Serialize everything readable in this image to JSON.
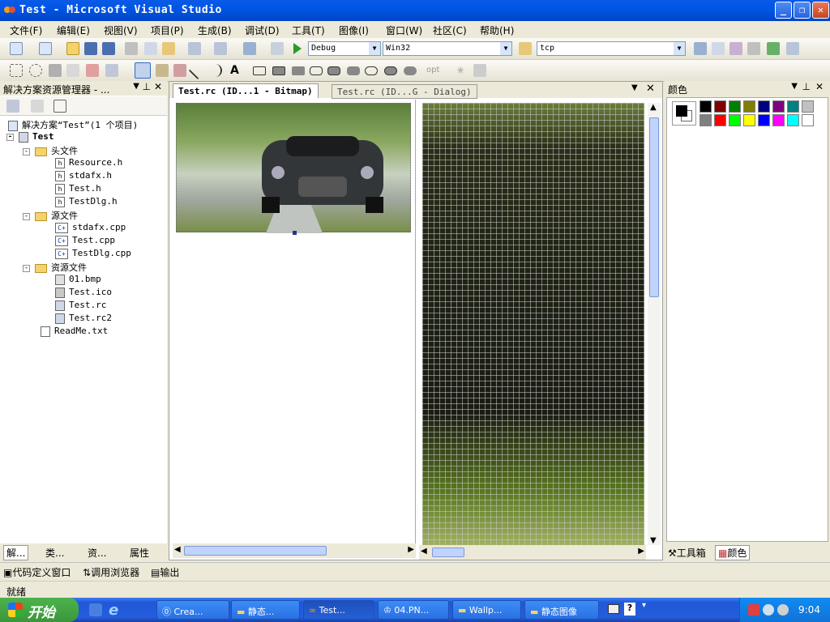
{
  "window": {
    "title": "Test - Microsoft Visual Studio"
  },
  "menu": [
    "文件(F)",
    "编辑(E)",
    "视图(V)",
    "项目(P)",
    "生成(B)",
    "调试(D)",
    "工具(T)",
    "图像(I)",
    "窗口(W)",
    "社区(C)",
    "帮助(H)"
  ],
  "toolbar": {
    "config": "Debug",
    "platform": "Win32",
    "find": "tcp",
    "opt_label": "opt"
  },
  "solution_explorer": {
    "title": "解决方案资源管理器 - ...",
    "solution_label": "解决方案“Test”(1 个项目)",
    "project": "Test",
    "folders": [
      {
        "name": "头文件",
        "files": [
          "Resource.h",
          "stdafx.h",
          "Test.h",
          "TestDlg.h"
        ]
      },
      {
        "name": "源文件",
        "files": [
          "stdafx.cpp",
          "Test.cpp",
          "TestDlg.cpp"
        ]
      },
      {
        "name": "资源文件",
        "files": [
          "01.bmp",
          "Test.ico",
          "Test.rc",
          "Test.rc2"
        ]
      }
    ],
    "extra_file": "ReadMe.txt",
    "bottom_tabs": [
      "解...",
      "类...",
      "资...",
      "属性"
    ]
  },
  "editor": {
    "tabs": [
      "Test.rc (ID...1 - Bitmap)",
      "Test.rc (ID...G - Dialog)"
    ]
  },
  "colors_panel": {
    "title": "颜色",
    "bottom_tabs": [
      "工具箱",
      "颜色"
    ],
    "palette": [
      "#000000",
      "#800000",
      "#008000",
      "#808000",
      "#000080",
      "#800080",
      "#008080",
      "#c0c0c0",
      "#808080",
      "#ff0000",
      "#00ff00",
      "#ffff00",
      "#0000ff",
      "#ff00ff",
      "#00ffff",
      "#ffffff"
    ]
  },
  "bottom_tabs": [
    "代码定义窗口",
    "调用浏览器",
    "输出"
  ],
  "status": "就绪",
  "taskbar": {
    "start": "开始",
    "tasks": [
      "Crea...",
      "静态...",
      "Test...",
      "04.PN...",
      "Wallp...",
      "静态图像"
    ],
    "active_index": 2,
    "time": "9:04"
  }
}
